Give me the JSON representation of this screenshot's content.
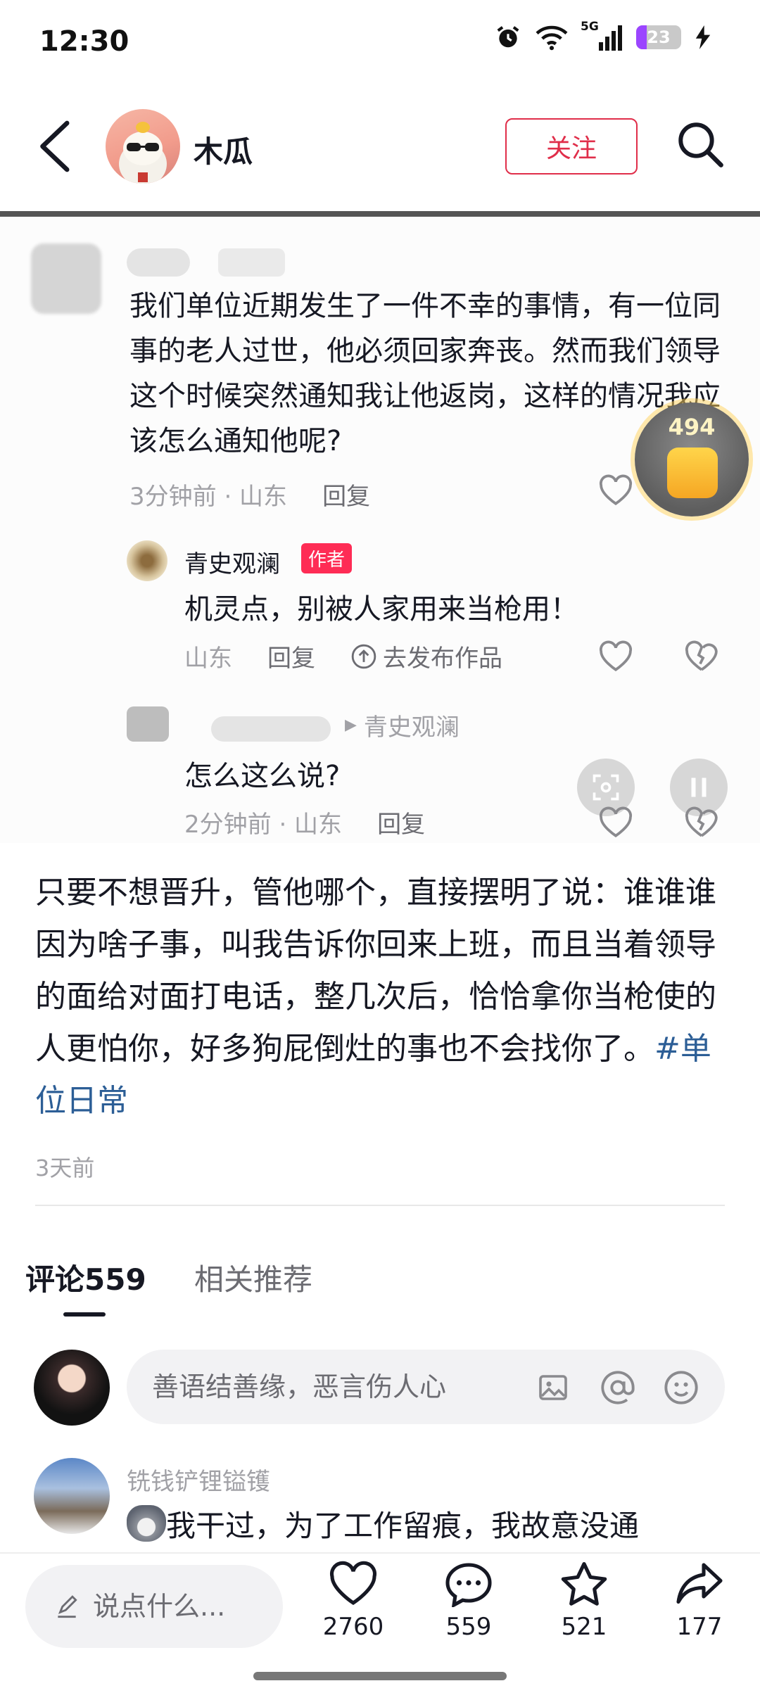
{
  "status_bar": {
    "time": "12:30",
    "network": "5G",
    "battery": "23",
    "battery_level": 0.23
  },
  "header": {
    "author_name": "木瓜",
    "follow_label": "关注"
  },
  "screenshot": {
    "question_text": "我们单位近期发生了一件不幸的事情，有一位同事的老人过世，他必须回家奔丧。然而我们领导这个时候突然通知我让他返岗，这样的情况我应该怎么通知他呢?",
    "question_meta": "3分钟前 · 山东",
    "reply_label": "回复",
    "coin_count": "494",
    "reply1": {
      "name": "青史观澜",
      "badge": "作者",
      "text": "机灵点，别被人家用来当枪用！",
      "location": "山东",
      "reply_label": "回复",
      "publish_label": "去发布作品"
    },
    "reply2": {
      "to_name": "青史观澜",
      "text": "怎么这么说?",
      "meta": "2分钟前 · 山东",
      "reply_label": "回复"
    }
  },
  "post": {
    "body_text": "只要不想晋升，管他哪个，直接摆明了说：谁谁谁因为啥子事，叫我告诉你回来上班，而且当着领导的面给对面打电话，整几次后，恰恰拿你当枪使的人更怕你，好多狗屁倒灶的事也不会找你了。",
    "hashtag": "#单位日常",
    "time": "3天前"
  },
  "tabs": [
    {
      "label": "评论559",
      "active": true
    },
    {
      "label": "相关推荐",
      "active": false
    }
  ],
  "comment_input": {
    "placeholder": "善语结善缘，恶言伤人心"
  },
  "first_comment": {
    "name": "铣钱铲锂镒镬",
    "text": "我干过，为了工作留痕，我故意没通"
  },
  "bottom_bar": {
    "say_placeholder": "说点什么...",
    "likes": "2760",
    "comments": "559",
    "favorites": "521",
    "shares": "177"
  },
  "colors": {
    "accent_red": "#e02e4a",
    "badge_red": "#fe2c55",
    "hashtag_blue": "#2c5e96"
  }
}
